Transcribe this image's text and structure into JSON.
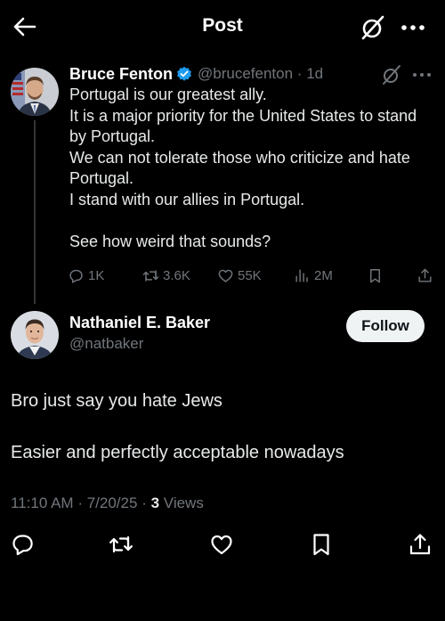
{
  "header": {
    "title": "Post"
  },
  "quoted_post": {
    "display_name": "Bruce Fenton",
    "handle": "@brucefenton",
    "separator": "·",
    "time": "1d",
    "lines": [
      "Portugal is our greatest ally.",
      "It is a major priority for the United States to stand by Portugal.",
      "We can not tolerate those who criticize and hate Portugal.",
      "I stand with our allies in Portugal.",
      "",
      "See how weird that sounds?"
    ],
    "stats": {
      "replies": "1K",
      "reposts": "3.6K",
      "likes": "55K",
      "views": "2M"
    }
  },
  "reply": {
    "display_name": "Nathaniel E. Baker",
    "handle": "@natbaker",
    "follow_label": "Follow",
    "lines": [
      "Bro just say you hate Jews",
      "",
      "Easier and perfectly acceptable nowadays"
    ],
    "time": "11:10 AM",
    "date": "7/20/25",
    "dot": "·",
    "views_count": "3",
    "views_label": "Views"
  },
  "colors": {
    "background": "#000000",
    "text_primary": "#e7e9ea",
    "text_secondary": "#71767b",
    "verified_badge": "#1d9bf0",
    "follow_bg": "#eff3f4"
  },
  "icons": {
    "back": "arrow-left-icon",
    "grok": "grok-icon",
    "more": "more-horizontal-icon",
    "verified": "verified-badge-icon",
    "reply": "reply-icon",
    "repost": "repost-icon",
    "like": "heart-icon",
    "views": "views-chart-icon",
    "bookmark": "bookmark-icon",
    "share": "share-icon"
  }
}
